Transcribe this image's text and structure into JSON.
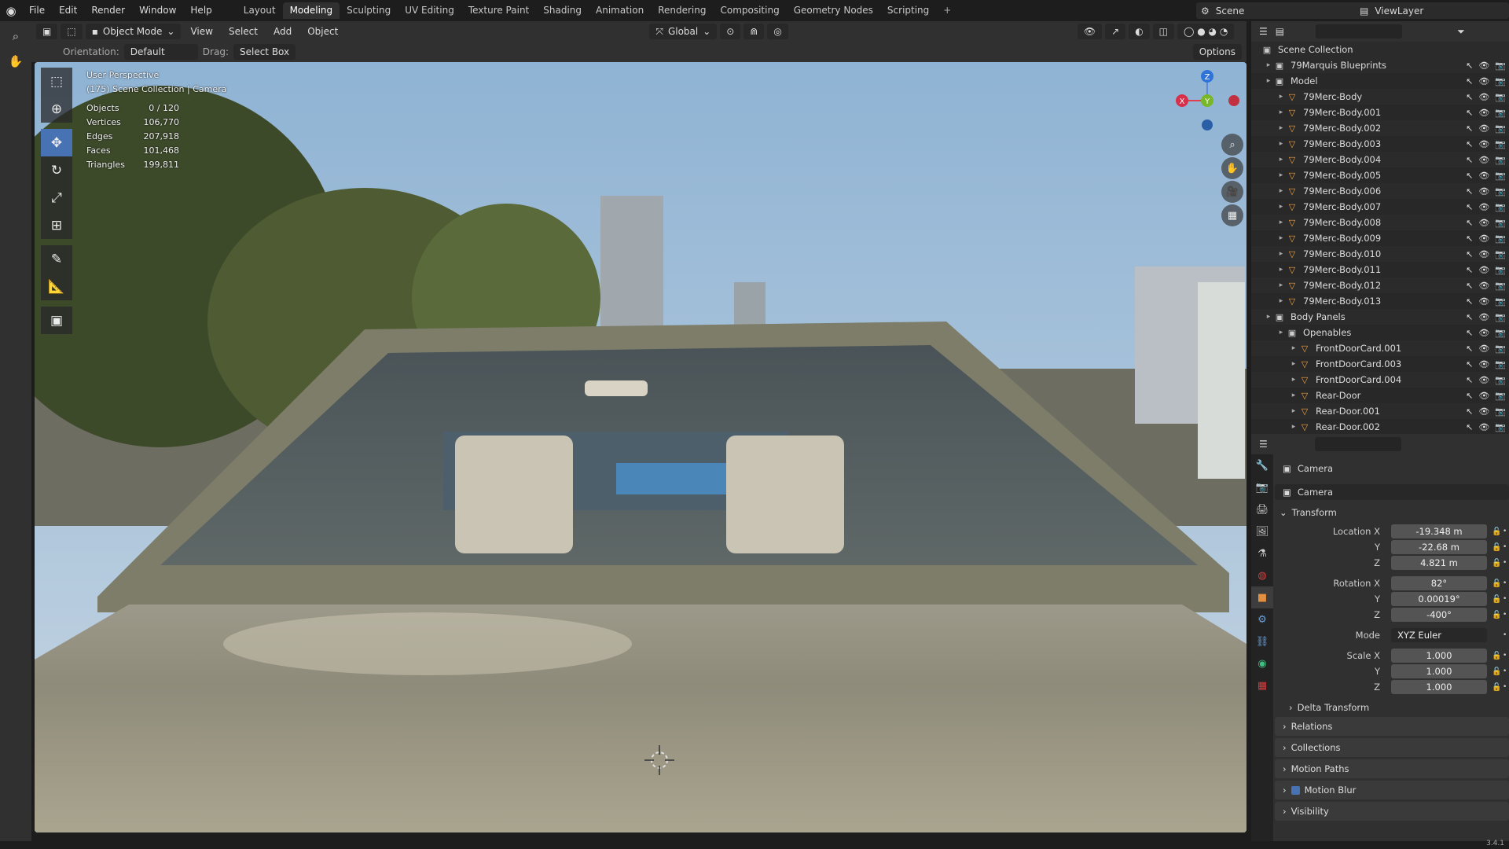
{
  "menu": [
    "File",
    "Edit",
    "Render",
    "Window",
    "Help"
  ],
  "workspaces": [
    "Layout",
    "Modeling",
    "Sculpting",
    "UV Editing",
    "Texture Paint",
    "Shading",
    "Animation",
    "Rendering",
    "Compositing",
    "Geometry Nodes",
    "Scripting"
  ],
  "active_workspace": "Modeling",
  "scene": "Scene",
  "view_layer": "ViewLayer",
  "viewport_header": {
    "mode": "Object Mode",
    "view": "View",
    "select": "Select",
    "add": "Add",
    "object": "Object",
    "transform": "Global"
  },
  "tool_settings": {
    "orientation_label": "Orientation:",
    "orientation": "Default",
    "drag_label": "Drag:",
    "drag": "Select Box",
    "options": "Options"
  },
  "overlay": {
    "perspective": "User Perspective",
    "collection": "(175) Scene Collection | Camera",
    "stats": [
      {
        "k": "Objects",
        "v": "0 / 120"
      },
      {
        "k": "Vertices",
        "v": "106,770"
      },
      {
        "k": "Edges",
        "v": "207,918"
      },
      {
        "k": "Faces",
        "v": "101,468"
      },
      {
        "k": "Triangles",
        "v": "199,811"
      }
    ]
  },
  "gizmo": {
    "x": "X",
    "y": "Y",
    "z": "Z"
  },
  "outliner": {
    "root": "Scene Collection",
    "rows": [
      {
        "label": "79Marquis Blueprints",
        "indent": 1,
        "type": "collection"
      },
      {
        "label": "Model",
        "indent": 1,
        "type": "collection"
      },
      {
        "label": "79Merc-Body",
        "indent": 2,
        "type": "mesh"
      },
      {
        "label": "79Merc-Body.001",
        "indent": 2,
        "type": "mesh"
      },
      {
        "label": "79Merc-Body.002",
        "indent": 2,
        "type": "mesh"
      },
      {
        "label": "79Merc-Body.003",
        "indent": 2,
        "type": "mesh"
      },
      {
        "label": "79Merc-Body.004",
        "indent": 2,
        "type": "mesh"
      },
      {
        "label": "79Merc-Body.005",
        "indent": 2,
        "type": "mesh"
      },
      {
        "label": "79Merc-Body.006",
        "indent": 2,
        "type": "mesh"
      },
      {
        "label": "79Merc-Body.007",
        "indent": 2,
        "type": "mesh"
      },
      {
        "label": "79Merc-Body.008",
        "indent": 2,
        "type": "mesh"
      },
      {
        "label": "79Merc-Body.009",
        "indent": 2,
        "type": "mesh"
      },
      {
        "label": "79Merc-Body.010",
        "indent": 2,
        "type": "mesh"
      },
      {
        "label": "79Merc-Body.011",
        "indent": 2,
        "type": "mesh"
      },
      {
        "label": "79Merc-Body.012",
        "indent": 2,
        "type": "mesh"
      },
      {
        "label": "79Merc-Body.013",
        "indent": 2,
        "type": "mesh"
      },
      {
        "label": "Body Panels",
        "indent": 1,
        "type": "collection"
      },
      {
        "label": "Openables",
        "indent": 2,
        "type": "collection"
      },
      {
        "label": "FrontDoorCard.001",
        "indent": 3,
        "type": "mesh"
      },
      {
        "label": "FrontDoorCard.003",
        "indent": 3,
        "type": "mesh"
      },
      {
        "label": "FrontDoorCard.004",
        "indent": 3,
        "type": "mesh"
      },
      {
        "label": "Rear-Door",
        "indent": 3,
        "type": "mesh"
      },
      {
        "label": "Rear-Door.001",
        "indent": 3,
        "type": "mesh"
      },
      {
        "label": "Rear-Door.002",
        "indent": 3,
        "type": "mesh"
      }
    ]
  },
  "properties": {
    "object_name": "Camera",
    "data_name": "Camera",
    "transform_label": "Transform",
    "location_label": "Location X",
    "location": [
      "-19.348 m",
      "-22.68 m",
      "4.821 m"
    ],
    "rotation_label": "Rotation X",
    "rotation": [
      "82°",
      "0.00019°",
      "-400°"
    ],
    "mode_label": "Mode",
    "mode": "XYZ Euler",
    "scale_label": "Scale X",
    "scale": [
      "1.000",
      "1.000",
      "1.000"
    ],
    "axis_y": "Y",
    "axis_z": "Z",
    "panels": [
      "Delta Transform",
      "Relations",
      "Collections",
      "Motion Paths",
      "Motion Blur",
      "Visibility"
    ]
  },
  "version": "3.4.1"
}
